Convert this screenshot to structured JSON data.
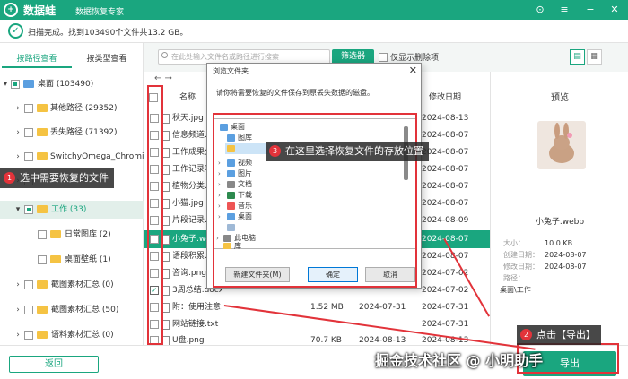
{
  "app": {
    "logo_glyph": "+",
    "name": "数据蛙",
    "subtitle": "数据恢复专家",
    "win_controls": [
      "⊙",
      "≡",
      "−",
      "✕"
    ]
  },
  "scan": {
    "message": "扫描完成。找到103490个文件共13.2 GB。"
  },
  "tabs": [
    {
      "label": "按路径查看",
      "active": true
    },
    {
      "label": "按类型查看",
      "active": false
    }
  ],
  "tree": [
    {
      "label": "桌面 (103490)",
      "state": "partial",
      "expanded": true
    },
    {
      "label": "其他路径 (29352)",
      "state": "none"
    },
    {
      "label": "丢失路径 (71392)",
      "state": "none"
    },
    {
      "label": "SwitchyOmega_Chromium",
      "state": "none"
    },
    {
      "label": "",
      "state": "none"
    },
    {
      "label": "工作 (33)",
      "state": "partial",
      "expanded": true,
      "selected": true
    },
    {
      "label": "日常图库 (2)",
      "state": "none"
    },
    {
      "label": "桌面壁纸 (1)",
      "state": "none"
    },
    {
      "label": "截图素材汇总 (0)",
      "state": "none"
    },
    {
      "label": "截图素材汇总 (50)",
      "state": "none"
    },
    {
      "label": "语料素材汇总 (0)",
      "state": "none"
    }
  ],
  "search": {
    "placeholder": "在此处输入文件名或路径进行搜索"
  },
  "toolbar": {
    "filter_label": "筛选器",
    "deleted_only_label": "仅显示删除项",
    "view_list_icon": "▤",
    "view_grid_icon": "▦"
  },
  "nav": {
    "arrows": "← →"
  },
  "columns": {
    "name": "名称",
    "modified": "修改日期"
  },
  "files": [
    {
      "name": "秋天.jpg",
      "size": "",
      "date1": "",
      "date2": "2024-08-13"
    },
    {
      "name": "信息频道.txt",
      "size": "",
      "date1": "",
      "date2": "2024-08-07"
    },
    {
      "name": "工作成果分享",
      "size": "",
      "date1": "",
      "date2": "2024-08-07"
    },
    {
      "name": "工作记录表.xlsx",
      "size": "",
      "date1": "",
      "date2": "2024-08-07"
    },
    {
      "name": "植物分类.docx",
      "size": "",
      "date1": "",
      "date2": "2024-08-07"
    },
    {
      "name": "小猫.jpg",
      "size": "",
      "date1": "",
      "date2": "2024-08-07"
    },
    {
      "name": "片段记录.docx",
      "size": "",
      "date1": "",
      "date2": "2024-08-09"
    },
    {
      "name": "小兔子.webp",
      "size": "",
      "date1": "",
      "date2": "2024-08-07",
      "selected": true
    },
    {
      "name": "语段积累.docx",
      "size": "",
      "date1": "",
      "date2": "2024-08-07"
    },
    {
      "name": "咨询.png",
      "size": "",
      "date1": "",
      "date2": "2024-07-02"
    },
    {
      "name": "3周总结.docx",
      "size": "",
      "date1": "",
      "date2": "2024-07-02",
      "checked": true
    },
    {
      "name": "附：使用注意...",
      "size": "1.52 MB",
      "date1": "2024-07-31",
      "date2": "2024-07-31"
    },
    {
      "name": "网站链接.txt",
      "size": "",
      "date1": "",
      "date2": "2024-07-31"
    },
    {
      "name": "U盘.png",
      "size": "70.7 KB",
      "date1": "2024-08-13",
      "date2": "2024-08-13"
    }
  ],
  "preview": {
    "title": "预览",
    "filename": "小兔子.webp",
    "meta": [
      {
        "key": "大小：",
        "value": "10.0 KB"
      },
      {
        "key": "创建日期：",
        "value": "2024-08-07"
      },
      {
        "key": "修改日期：",
        "value": "2024-08-07"
      },
      {
        "key": "路径：",
        "value": ""
      },
      {
        "key": "",
        "value": "桌面\\工作"
      }
    ]
  },
  "dialog": {
    "title": "浏览文件夹",
    "close_glyph": "✕",
    "message": "请你将需要恢复的文件保存到原丢失数据的磁盘。",
    "tree": [
      "桌面",
      "图库",
      "",
      "视频",
      "图片",
      "文档",
      "下载",
      "音乐",
      "桌面",
      "",
      "此电脑",
      "库"
    ],
    "new_folder": "新建文件夹(M)",
    "ok": "确定",
    "cancel": "取消"
  },
  "bottom": {
    "back": "返回",
    "export": "导出"
  },
  "callouts": [
    {
      "num": "1",
      "text": "选中需要恢复的文件"
    },
    {
      "num": "2",
      "text": "点击【导出】"
    },
    {
      "num": "3",
      "text": "在这里选择恢复文件的存放位置"
    }
  ],
  "watermark": "掘金技术社区 @ 小明助手"
}
